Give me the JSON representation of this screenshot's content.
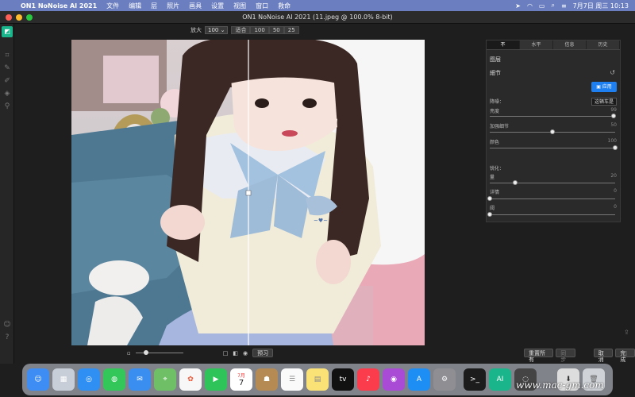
{
  "menubar": {
    "app": "ON1 NoNoise AI 2021",
    "items": [
      "文件",
      "编辑",
      "层",
      "照片",
      "画具",
      "设置",
      "视图",
      "窗口",
      "救命"
    ],
    "clock": "7月7日 周三 10:13"
  },
  "window": {
    "title": "ON1 NoNoise AI 2021 (11.jpeg @ 100.0% 8-bit)"
  },
  "zoom": {
    "label": "放大",
    "value": "100",
    "fit": "适合",
    "presets": [
      "100",
      "50",
      "25"
    ]
  },
  "preview": {
    "label": "预习"
  },
  "panel": {
    "tabs": [
      "不",
      "水平",
      "信息",
      "历史"
    ],
    "layer": "图层",
    "detail": "細节",
    "apply": "应用",
    "method": "这辆车是",
    "denoise_title": "降噪：",
    "sharpen_title": "锐化：",
    "denoise": [
      {
        "label": "亮度",
        "value": "99",
        "level": 0.99
      },
      {
        "label": "加强细节",
        "value": "50",
        "level": 0.5
      },
      {
        "label": "颜色",
        "value": "100",
        "level": 1.0
      }
    ],
    "sharpen": [
      {
        "label": "量",
        "value": "20",
        "level": 0.2
      },
      {
        "label": "详情",
        "value": "0",
        "level": 0
      },
      {
        "label": "阈",
        "value": "0",
        "level": 0
      }
    ]
  },
  "buttons": {
    "reset_all": "重置所有",
    "sync": "同步",
    "cancel": "取消",
    "done": "完成"
  },
  "dock_text": {
    "calendar_month": "7月",
    "calendar_day": "7",
    "tv": "tv",
    "ai": "AI"
  },
  "watermark": "www.mac-gm.com"
}
